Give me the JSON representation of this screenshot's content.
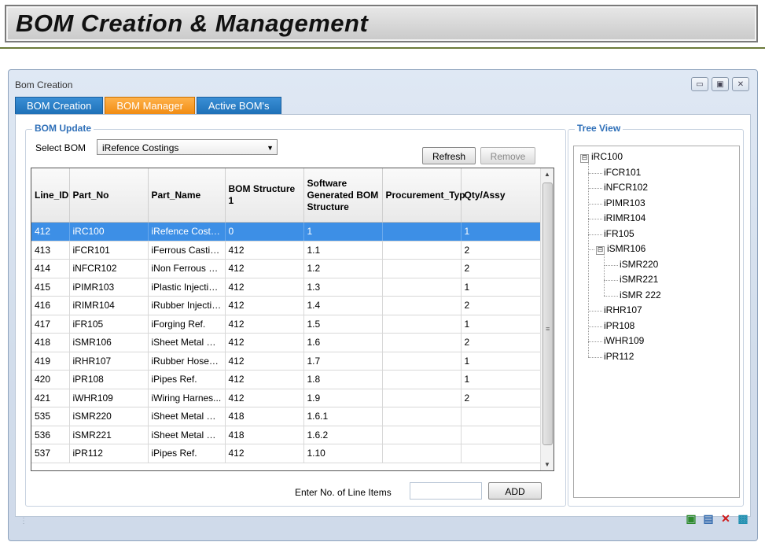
{
  "page": {
    "title": "BOM Creation & Management"
  },
  "window": {
    "title": "Bom Creation",
    "controls": {
      "minimize": "▭",
      "restore": "▣",
      "close": "✕"
    }
  },
  "tabs": [
    {
      "label": "BOM Creation",
      "active": false
    },
    {
      "label": "BOM Manager",
      "active": true
    },
    {
      "label": "Active BOM's",
      "active": false
    }
  ],
  "bom_update": {
    "group_label": "BOM Update",
    "select_label": "Select BOM",
    "selected_bom": "iRefence Costings",
    "refresh_label": "Refresh",
    "remove_label": "Remove",
    "columns": [
      "Line_ID",
      "Part_No",
      "Part_Name",
      "BOM Structure 1",
      "Software Generated BOM Structure",
      "Procurement_Typ",
      "Qty/Assy"
    ],
    "rows": [
      {
        "line_id": "412",
        "part_no": "iRC100",
        "part_name": "iRefence Costin...",
        "bom_structure": "0",
        "software_bom": "1",
        "procurement": "",
        "qty": "1",
        "selected": true
      },
      {
        "line_id": "413",
        "part_no": "iFCR101",
        "part_name": "iFerrous Castin...",
        "bom_structure": "412",
        "software_bom": "1.1",
        "procurement": "",
        "qty": "2"
      },
      {
        "line_id": "414",
        "part_no": "iNFCR102",
        "part_name": "iNon Ferrous C...",
        "bom_structure": "412",
        "software_bom": "1.2",
        "procurement": "",
        "qty": "2"
      },
      {
        "line_id": "415",
        "part_no": "iPIMR103",
        "part_name": "iPlastic Injectio...",
        "bom_structure": "412",
        "software_bom": "1.3",
        "procurement": "",
        "qty": "1"
      },
      {
        "line_id": "416",
        "part_no": "iRIMR104",
        "part_name": "iRubber Injectio...",
        "bom_structure": "412",
        "software_bom": "1.4",
        "procurement": "",
        "qty": "2"
      },
      {
        "line_id": "417",
        "part_no": "iFR105",
        "part_name": "iForging Ref.",
        "bom_structure": "412",
        "software_bom": "1.5",
        "procurement": "",
        "qty": "1"
      },
      {
        "line_id": "418",
        "part_no": "iSMR106",
        "part_name": "iSheet Metal Ref.",
        "bom_structure": "412",
        "software_bom": "1.6",
        "procurement": "",
        "qty": "2"
      },
      {
        "line_id": "419",
        "part_no": "iRHR107",
        "part_name": "iRubber Hoses ...",
        "bom_structure": "412",
        "software_bom": "1.7",
        "procurement": "",
        "qty": "1"
      },
      {
        "line_id": "420",
        "part_no": "iPR108",
        "part_name": "iPipes Ref.",
        "bom_structure": "412",
        "software_bom": "1.8",
        "procurement": "",
        "qty": "1"
      },
      {
        "line_id": "421",
        "part_no": "iWHR109",
        "part_name": "iWiring Harnes...",
        "bom_structure": "412",
        "software_bom": "1.9",
        "procurement": "",
        "qty": "2"
      },
      {
        "line_id": "535",
        "part_no": "iSMR220",
        "part_name": "iSheet Metal Re...",
        "bom_structure": "418",
        "software_bom": "1.6.1",
        "procurement": "",
        "qty": ""
      },
      {
        "line_id": "536",
        "part_no": "iSMR221",
        "part_name": "iSheet Metal Re...",
        "bom_structure": "418",
        "software_bom": "1.6.2",
        "procurement": "",
        "qty": ""
      },
      {
        "line_id": "537",
        "part_no": "iPR112",
        "part_name": "iPipes Ref.",
        "bom_structure": "412",
        "software_bom": "1.10",
        "procurement": "",
        "qty": ""
      }
    ],
    "line_items_label": "Enter No. of Line Items",
    "line_items_value": "",
    "add_label": "ADD"
  },
  "tree_view": {
    "label": "Tree View",
    "root": "iRC100",
    "children": [
      "iFCR101",
      "iNFCR102",
      "iPIMR103",
      "iRIMR104",
      "iFR105"
    ],
    "expanded_child": "iSMR106",
    "grandchildren": [
      "iSMR220",
      "iSMR221",
      "iSMR 222"
    ],
    "after": [
      "iRHR107",
      "iPR108",
      "iWHR109",
      "iPR112"
    ],
    "expand_glyph": "⊟"
  },
  "colors": {
    "tab_active": "#f08a10",
    "tab_inactive": "#1d6fb6",
    "selected_row": "#3d8fe6",
    "group_label": "#2e6fb8"
  },
  "bottom_icons": [
    "export-icon",
    "save-icon",
    "delete-icon",
    "lock-icon"
  ]
}
